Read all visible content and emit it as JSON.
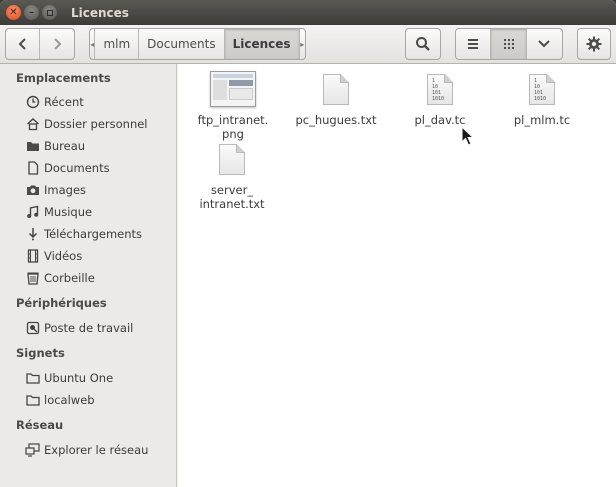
{
  "window": {
    "title": "Licences"
  },
  "toolbar": {
    "breadcrumbs": [
      "mlm",
      "Documents",
      "Licences"
    ]
  },
  "sidebar": {
    "sections": [
      {
        "title": "Emplacements"
      },
      {
        "title": "Périphériques"
      },
      {
        "title": "Signets"
      },
      {
        "title": "Réseau"
      }
    ],
    "places": [
      {
        "label": "Récent",
        "icon": "clock-icon"
      },
      {
        "label": "Dossier personnel",
        "icon": "home-icon"
      },
      {
        "label": "Bureau",
        "icon": "folder-icon"
      },
      {
        "label": "Documents",
        "icon": "document-icon"
      },
      {
        "label": "Images",
        "icon": "camera-icon"
      },
      {
        "label": "Musique",
        "icon": "music-icon"
      },
      {
        "label": "Téléchargements",
        "icon": "download-icon"
      },
      {
        "label": "Vidéos",
        "icon": "film-icon"
      },
      {
        "label": "Corbeille",
        "icon": "trash-icon"
      }
    ],
    "devices": [
      {
        "label": "Poste de travail",
        "icon": "drive-icon"
      }
    ],
    "bookmarks": [
      {
        "label": "Ubuntu One",
        "icon": "folder-icon"
      },
      {
        "label": "localweb",
        "icon": "folder-icon"
      }
    ],
    "network": [
      {
        "label": "Explorer le réseau",
        "icon": "network-icon"
      }
    ]
  },
  "files": [
    {
      "name": "ftp_intranet.\npng",
      "icon": "image-thumbnail-icon"
    },
    {
      "name": "pc_hugues.txt",
      "icon": "text-file-icon"
    },
    {
      "name": "pl_dav.tc",
      "icon": "binary-file-icon"
    },
    {
      "name": "pl_mlm.tc",
      "icon": "binary-file-icon"
    },
    {
      "name": "server_\nintranet.txt",
      "icon": "text-file-icon"
    }
  ]
}
